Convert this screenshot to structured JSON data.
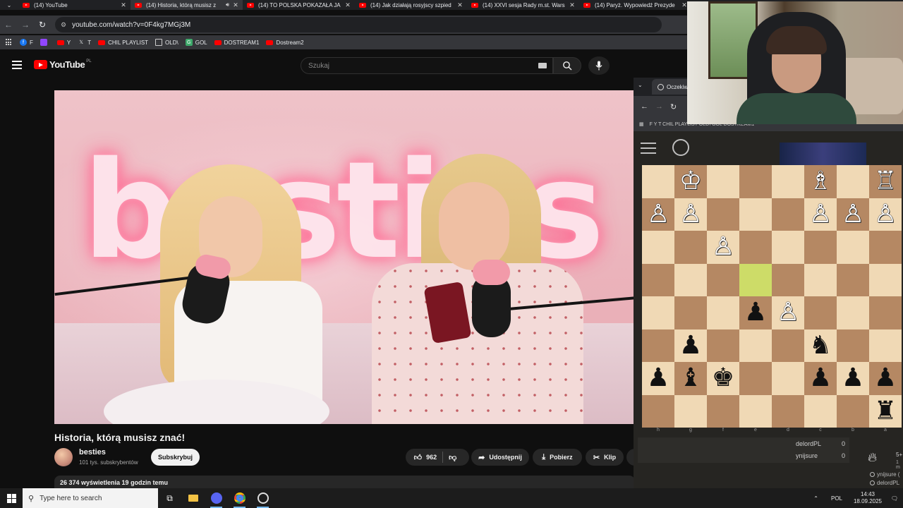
{
  "browser": {
    "tabs": [
      {
        "title": "(14) YouTube",
        "active": false
      },
      {
        "title": "(14) Historia, którą musisz z",
        "active": true
      },
      {
        "title": "(14) TO POLSKA POKAZAŁA JA",
        "active": false
      },
      {
        "title": "(14) Jak działają rosyjscy szpied",
        "active": false
      },
      {
        "title": "(14) XXVI sesja Rady m.st. Wars",
        "active": false
      },
      {
        "title": "(14) Paryż. Wypowiedź Prezyde",
        "active": false
      }
    ],
    "url": "youtube.com/watch?v=0F4kg7MGj3M",
    "bookmarks": [
      "F",
      "",
      "Y",
      "T",
      "CHIL PLAYLIST",
      "OLD\\",
      "GOL",
      "DOSTREAM1",
      "Dostream2"
    ]
  },
  "youtube": {
    "logo_text": "YouTube",
    "region": "PL",
    "search_placeholder": "Szukaj",
    "video_title": "Historia, którą musisz znać!",
    "neon_sign": "besties",
    "channel": {
      "name": "besties",
      "subscribers": "101 tys. subskrybentów"
    },
    "subscribe_label": "Subskrybuj",
    "likes": "962",
    "share_label": "Udostępnij",
    "download_label": "Pobierz",
    "clip_label": "Klip",
    "stats": "26 374 wyświetlenia  19 godzin temu"
  },
  "chess": {
    "tab_title": "Oczekiw",
    "bookmarks": "F    Y    T    CHIL PLAYLIST    OLD\\    GOL    DOSTREAM1",
    "files": [
      "h",
      "g",
      "f",
      "e",
      "d",
      "c",
      "b",
      "a"
    ],
    "board": [
      [
        "",
        "wK",
        "",
        "",
        "",
        "wB",
        "",
        "wR"
      ],
      [
        "wP",
        "wP",
        "",
        "",
        "",
        "wP",
        "wP",
        "wP"
      ],
      [
        "",
        "",
        "wP",
        "",
        "",
        "",
        "",
        ""
      ],
      [
        "",
        "",
        "",
        "hl",
        "",
        "",
        "",
        ""
      ],
      [
        "",
        "",
        "",
        "bP",
        "wP",
        "",
        "",
        ""
      ],
      [
        "",
        "bP",
        "",
        "",
        "",
        "bN",
        "",
        ""
      ],
      [
        "bP",
        "bB",
        "bK",
        "",
        "",
        "bP",
        "bP",
        "bP"
      ],
      [
        "",
        "",
        "",
        "",
        "",
        "",
        "",
        "bR"
      ]
    ],
    "scores": [
      {
        "name": "delordPL",
        "score": "0"
      },
      {
        "name": "ynijsure",
        "score": "0"
      }
    ],
    "time_control": "5+",
    "time_control_sub": "1 m",
    "watchers": [
      "ynijsure (",
      "delordPL"
    ]
  },
  "taskbar": {
    "search_placeholder": "Type here to search",
    "lang": "POL",
    "time": "14:43",
    "date": "18.09.2025"
  },
  "colors": {
    "yt_red": "#ff0000",
    "board_light": "#f0d9b5",
    "board_dark": "#b58863",
    "highlight": "#cddc68"
  }
}
